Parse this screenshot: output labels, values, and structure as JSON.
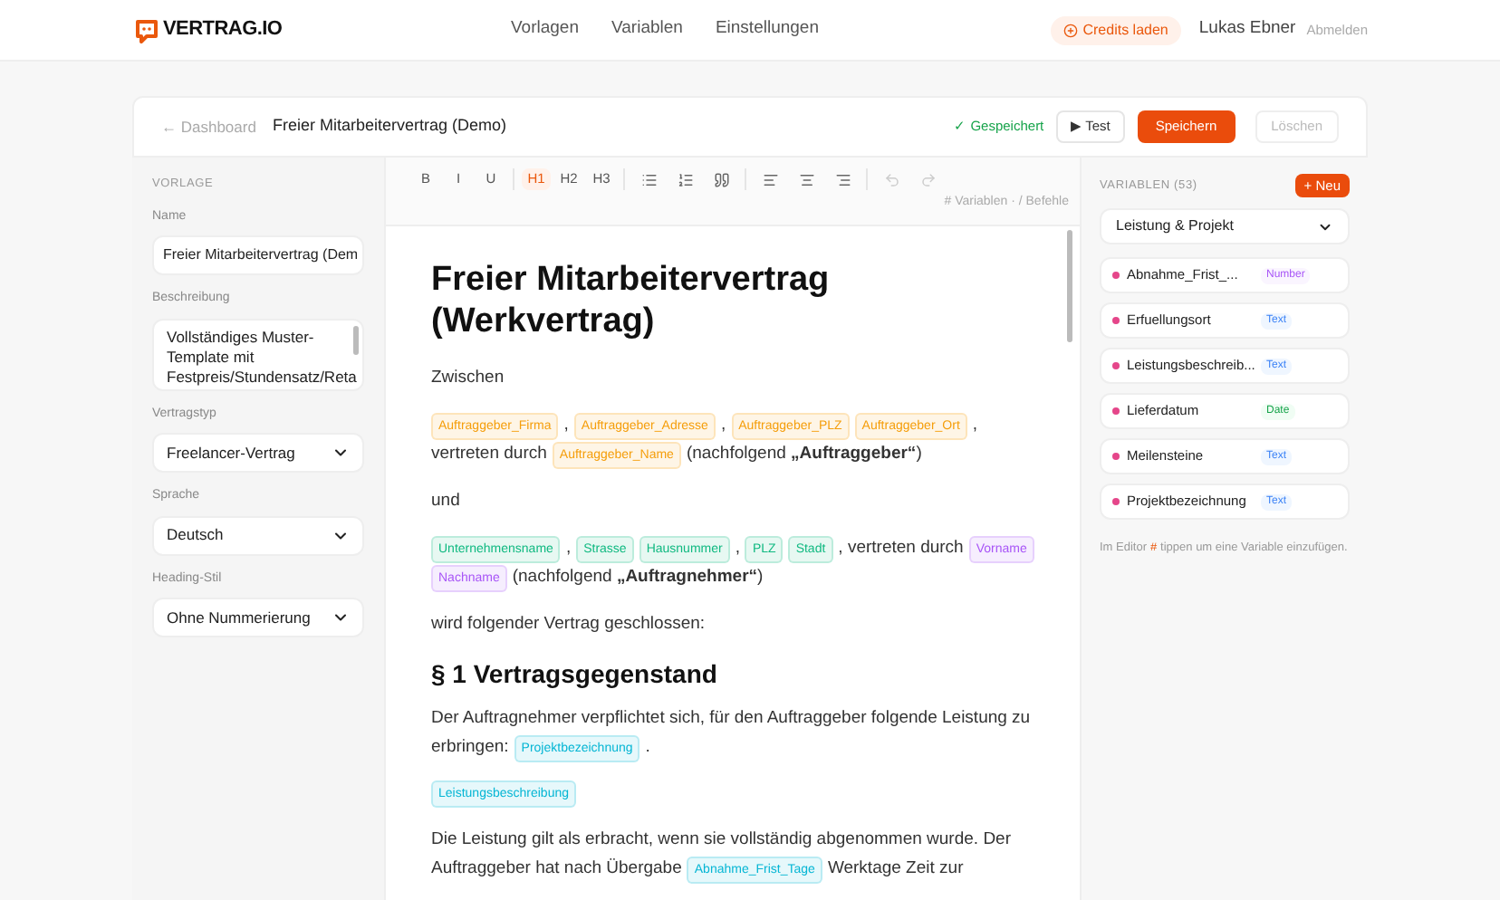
{
  "brand": {
    "name": "VERTRAG.IO"
  },
  "nav": [
    {
      "label": "Vorlagen",
      "selected": false
    },
    {
      "label": "Variablen",
      "selected": false
    },
    {
      "label": "Einstellungen",
      "selected": false
    }
  ],
  "account": {
    "credits_button": "Credits laden",
    "user": "Lukas Ebner",
    "logout": "Abmelden"
  },
  "toolbar": {
    "back": "← Dashboard",
    "title": "Freier Mitarbeitervertrag (Demo)",
    "status": "✓ Gespeichert",
    "test_button": "▶ Test",
    "save_button": "Speichern",
    "delete_button": "Löschen",
    "delete_disabled": true
  },
  "template_panel": {
    "heading": "VORLAGE",
    "fields": [
      {
        "kind": "input",
        "label": "Name",
        "value": "Freier Mitarbeitervertrag (Dem"
      },
      {
        "kind": "textarea",
        "label": "Beschreibung",
        "value": "Vollständiges Muster-Template mit Festpreis/Stundensatz/Reta"
      },
      {
        "kind": "select",
        "label": "Vertragstyp",
        "value": "Freelancer-Vertrag"
      },
      {
        "kind": "select",
        "label": "Sprache",
        "value": "Deutsch"
      },
      {
        "kind": "select",
        "label": "Heading-Stil",
        "value": "Ohne Nummerierung"
      }
    ]
  },
  "editor_toolbar": {
    "groups": [
      [
        {
          "kind": "text",
          "label": "B",
          "selected": false
        },
        {
          "kind": "text",
          "label": "I",
          "selected": false
        },
        {
          "kind": "text",
          "label": "U",
          "selected": false
        }
      ],
      [
        {
          "kind": "text",
          "label": "H1",
          "selected": true
        },
        {
          "kind": "text",
          "label": "H2",
          "selected": false
        },
        {
          "kind": "text",
          "label": "H3",
          "selected": false
        }
      ],
      [
        {
          "kind": "bullet-list",
          "disabled": false
        },
        {
          "kind": "numbered-list",
          "disabled": false
        },
        {
          "kind": "quote",
          "disabled": false
        }
      ],
      [
        {
          "kind": "align-left",
          "disabled": false
        },
        {
          "kind": "align-center",
          "disabled": false
        },
        {
          "kind": "align-right",
          "disabled": false
        }
      ],
      [
        {
          "kind": "undo",
          "disabled": true
        },
        {
          "kind": "redo",
          "disabled": true
        }
      ]
    ],
    "hint": "# Variablen · / Befehle"
  },
  "document": [
    {
      "kind": "heading1",
      "segments": [
        {
          "text": "Freier Mitarbeitervertrag (Werkvertrag)"
        }
      ]
    },
    {
      "kind": "paragraph",
      "segments": [
        {
          "text": "Zwischen"
        }
      ]
    },
    {
      "kind": "paragraph",
      "segments": [
        {
          "var": "Auftraggeber_Firma",
          "color": "#f59e0b"
        },
        {
          "text": ","
        },
        {
          "var": "Auftraggeber_Adresse",
          "color": "#f59e0b"
        },
        {
          "text": ","
        },
        {
          "var": "Auftraggeber_PLZ",
          "color": "#f59e0b"
        },
        {
          "var": "Auftraggeber_Ort",
          "color": "#f59e0b"
        },
        {
          "text": ","
        },
        {
          "text": "vertreten durch"
        },
        {
          "var": "Auftraggeber_Name",
          "color": "#f59e0b"
        },
        {
          "text": "(nachfolgend **„Auftraggeber“**)"
        }
      ]
    },
    {
      "kind": "paragraph",
      "segments": [
        {
          "text": "und"
        }
      ]
    },
    {
      "kind": "paragraph",
      "segments": [
        {
          "var": "Unternehmensname",
          "color": "#10b981"
        },
        {
          "text": ","
        },
        {
          "var": "Strasse",
          "color": "#10b981"
        },
        {
          "var": "Hausnummer",
          "color": "#10b981"
        },
        {
          "text": ","
        },
        {
          "var": "PLZ",
          "color": "#10b981"
        },
        {
          "var": "Stadt",
          "color": "#10b981"
        },
        {
          "text": ", vertreten durch"
        },
        {
          "var": "Vorname",
          "color": "#a855f7"
        },
        {
          "var": "Nachname",
          "color": "#a855f7"
        },
        {
          "text": "(nachfolgend **„Auftragnehmer“**)"
        }
      ]
    },
    {
      "kind": "paragraph",
      "segments": [
        {
          "text": "wird folgender Vertrag geschlossen:"
        }
      ]
    },
    {
      "kind": "heading2",
      "segments": [
        {
          "text": "§ 1 Vertragsgegenstand"
        }
      ]
    },
    {
      "kind": "paragraph",
      "segments": [
        {
          "text": "Der Auftragnehmer verpflichtet sich, für den Auftraggeber folgende Leistung zu"
        },
        {
          "text": "erbringen:"
        },
        {
          "var": "Projektbezeichnung",
          "color": "#06b6d4"
        },
        {
          "text": "."
        }
      ]
    },
    {
      "kind": "paragraph",
      "segments": [
        {
          "var": "Leistungsbeschreibung",
          "color": "#06b6d4"
        }
      ]
    },
    {
      "kind": "paragraph",
      "segments": [
        {
          "text": "Die Leistung gilt als erbracht, wenn sie vollständig abgenommen wurde. Der"
        },
        {
          "text": "Auftraggeber hat nach Übergabe"
        },
        {
          "var": "Abnahme_Frist_Tage",
          "color": "#06b6d4"
        },
        {
          "text": "Werktage Zeit zur"
        }
      ]
    }
  ],
  "variables_panel": {
    "heading": "VARIABLEN (53)",
    "new_button": "+ Neu",
    "category": "Leistung & Projekt",
    "items": [
      {
        "name": "Abnahme_Frist_...",
        "type": "Number",
        "kind": "number"
      },
      {
        "name": "Erfuellungsort",
        "type": "Text",
        "kind": "text"
      },
      {
        "name": "Leistungsbeschreib...",
        "type": "Text",
        "kind": "text"
      },
      {
        "name": "Lieferdatum",
        "type": "Date",
        "kind": "date"
      },
      {
        "name": "Meilensteine",
        "type": "Text",
        "kind": "text"
      },
      {
        "name": "Projektbezeichnung",
        "type": "Text",
        "kind": "text"
      }
    ],
    "hint_before": "Im Editor",
    "hint_key": "#",
    "hint_after": "tippen um eine Variable einzufügen."
  }
}
